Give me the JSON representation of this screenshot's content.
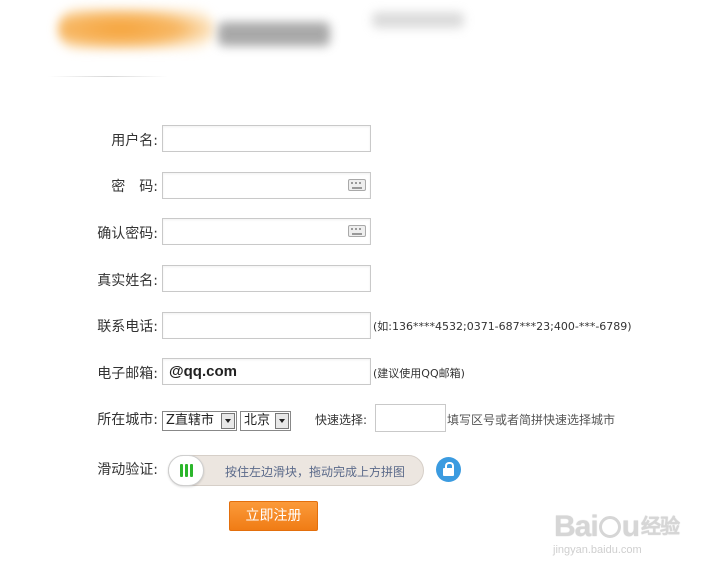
{
  "form": {
    "username_label": "用户名:",
    "password_label": "密　码:",
    "confirm_password_label": "确认密码:",
    "realname_label": "真实姓名:",
    "phone_label": "联系电话:",
    "phone_hint": "(如:136****4532;0371-687***23;400-***-6789)",
    "email_label": "电子邮箱:",
    "email_value": "@qq.com",
    "email_hint": "(建议使用QQ邮箱)",
    "city_label": "所在城市:",
    "province_value": "Z直辖市",
    "city_value": "北京",
    "quick_select_label": "快速选择:",
    "quick_select_hint": "填写区号或者简拼快速选择城市",
    "slider_label": "滑动验证:",
    "slider_text": "按住左边滑块，拖动完成上方拼图",
    "submit_label": "立即注册"
  },
  "watermark": {
    "brand": "Bai",
    "brand_tail": "u",
    "cn": "经验",
    "url": "jingyan.baidu.com"
  },
  "icons": {
    "keyboard": "keyboard-icon",
    "lock": "lock-icon",
    "dropdown": "chevron-down-icon"
  }
}
